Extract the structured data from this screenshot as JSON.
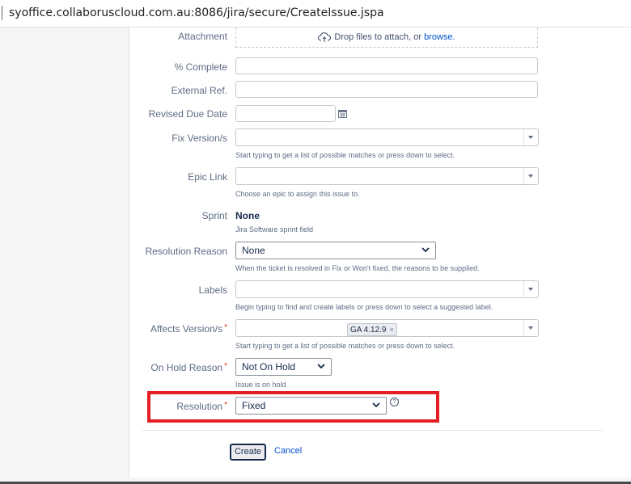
{
  "browser": {
    "url": "syoffice.collaboruscloud.com.au:8086/jira/secure/CreateIssue.jspa"
  },
  "form": {
    "attachment": {
      "label": "Attachment",
      "drop_text": "Drop files to attach, or",
      "browse_link": "browse."
    },
    "percent_complete": {
      "label": "% Complete",
      "value": ""
    },
    "external_ref": {
      "label": "External Ref.",
      "value": ""
    },
    "revised_due_date": {
      "label": "Revised Due Date",
      "value": ""
    },
    "fix_versions": {
      "label": "Fix Version/s",
      "value": "",
      "hint": "Start typing to get a list of possible matches or press down to select."
    },
    "epic_link": {
      "label": "Epic Link",
      "value": "",
      "hint": "Choose an epic to assign this issue to."
    },
    "sprint": {
      "label": "Sprint",
      "value": "None",
      "hint": "Jira Software sprint field"
    },
    "resolution_reason": {
      "label": "Resolution Reason",
      "value": "None",
      "hint": "When the ticket is resolved in Fix or Won't fixed, the reasons to be supplied."
    },
    "labels": {
      "label": "Labels",
      "value": "",
      "hint": "Begin typing to find and create labels or press down to select a suggested label."
    },
    "affects_versions": {
      "label": "Affects Version/s",
      "required_mark": "*",
      "tag": "GA 4.12.9",
      "tag_remove": "×",
      "hint": "Start typing to get a list of possible matches or press down to select."
    },
    "on_hold_reason": {
      "label": "On Hold Reason",
      "required_mark": "*",
      "value": "Not On Hold",
      "hint": "Issue is on hold"
    },
    "resolution": {
      "label": "Resolution",
      "required_mark": "*",
      "value": "Fixed",
      "help": "?"
    }
  },
  "actions": {
    "create_label": "Create",
    "cancel_label": "Cancel"
  },
  "colors": {
    "highlight": "#e31e25",
    "link": "#0052cc",
    "required": "#de350b"
  }
}
